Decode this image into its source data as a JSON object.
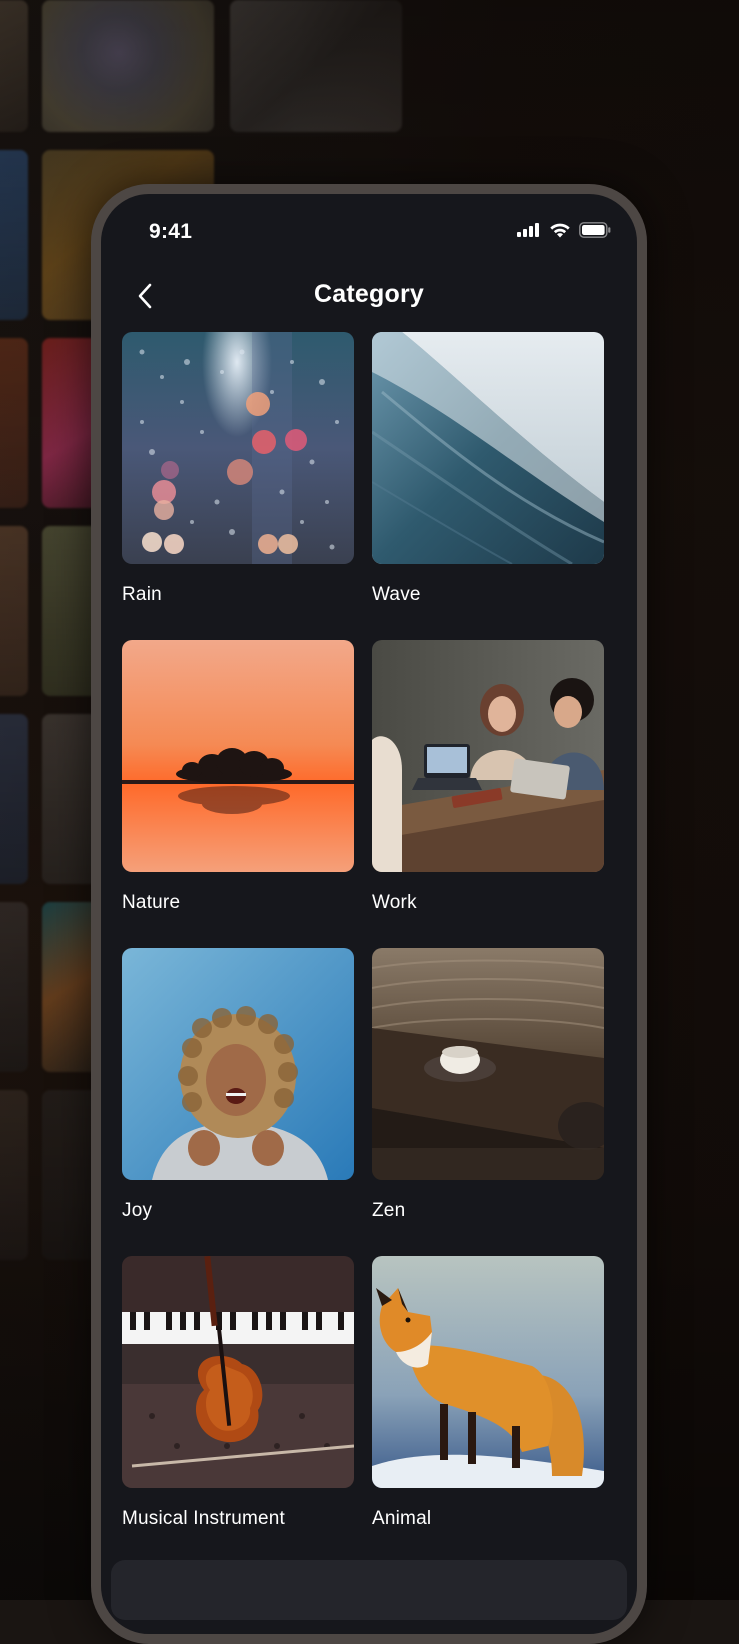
{
  "status_bar": {
    "time": "9:41",
    "icons": [
      "cellular-signal-icon",
      "wifi-icon",
      "battery-icon"
    ]
  },
  "header": {
    "title": "Category",
    "back_icon": "chevron-left-icon"
  },
  "categories": [
    {
      "label": "Rain"
    },
    {
      "label": "Wave"
    },
    {
      "label": "Nature"
    },
    {
      "label": "Work"
    },
    {
      "label": "Joy"
    },
    {
      "label": "Zen"
    },
    {
      "label": "Musical Instrument"
    },
    {
      "label": "Animal"
    }
  ],
  "colors": {
    "screen_background": "#16171c",
    "frame": "#4d4744",
    "text": "#ffffff"
  }
}
